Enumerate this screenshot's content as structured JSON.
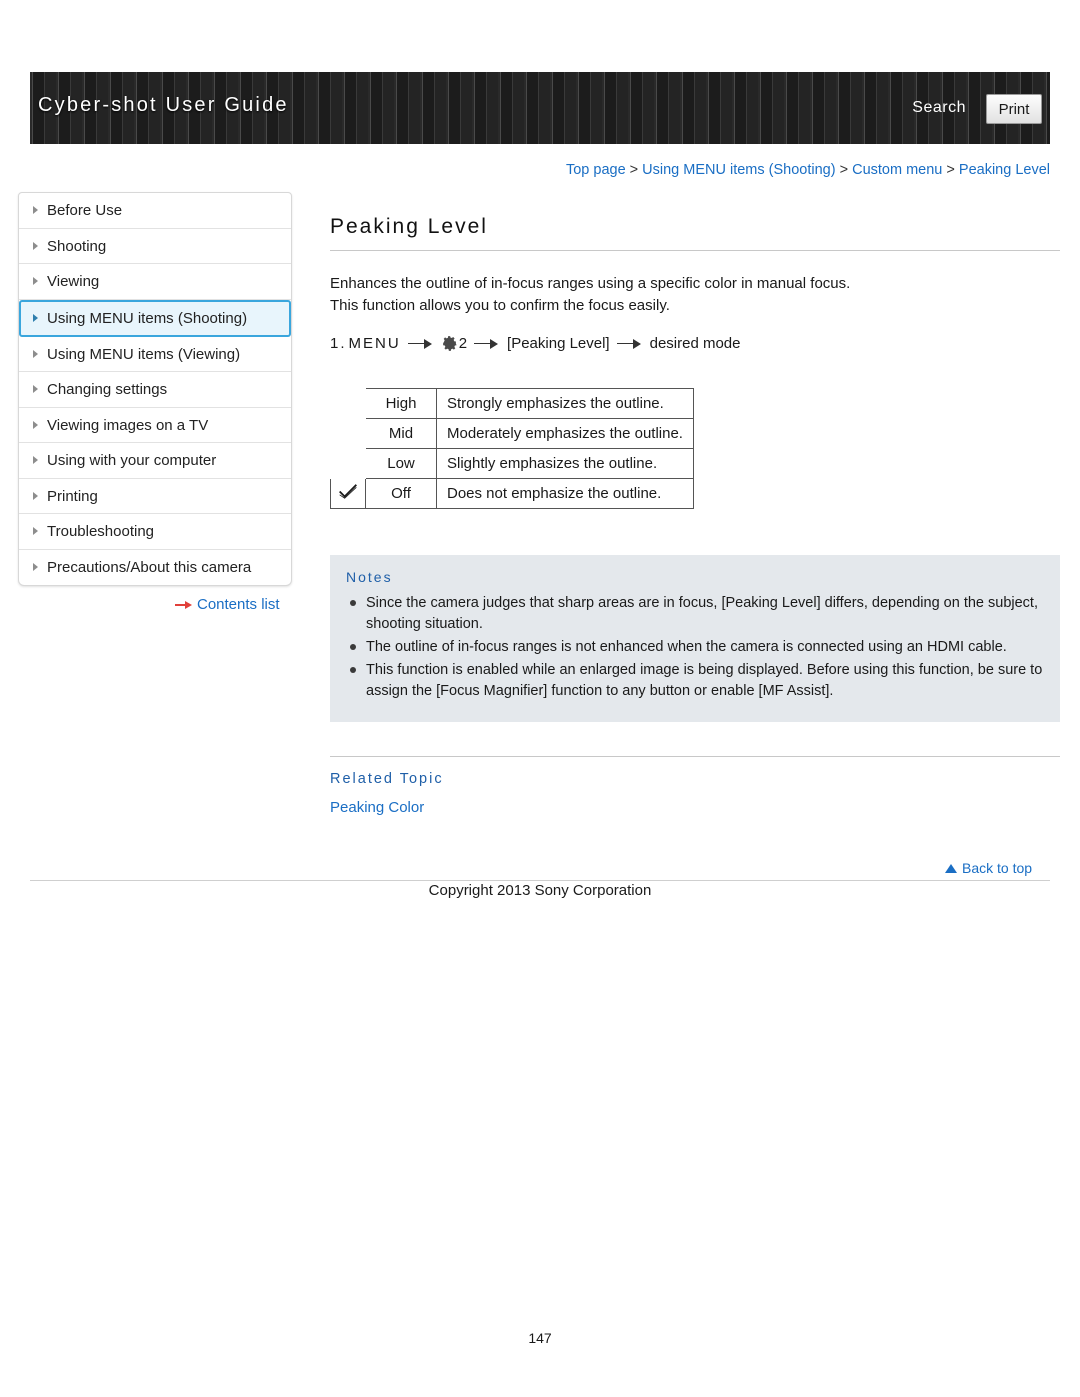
{
  "header": {
    "title": "Cyber-shot User Guide",
    "search_label": "Search",
    "print_label": "Print"
  },
  "breadcrumb": {
    "items": [
      "Top page",
      "Using MENU items (Shooting)",
      "Custom menu",
      "Peaking Level"
    ],
    "separator": ">"
  },
  "sidebar": {
    "items": [
      {
        "label": "Before Use",
        "active": false
      },
      {
        "label": "Shooting",
        "active": false
      },
      {
        "label": "Viewing",
        "active": false
      },
      {
        "label": "Using MENU items (Shooting)",
        "active": true
      },
      {
        "label": "Using MENU items (Viewing)",
        "active": false
      },
      {
        "label": "Changing settings",
        "active": false
      },
      {
        "label": "Viewing images on a TV",
        "active": false
      },
      {
        "label": "Using with your computer",
        "active": false
      },
      {
        "label": "Printing",
        "active": false
      },
      {
        "label": "Troubleshooting",
        "active": false
      },
      {
        "label": "Precautions/About this camera",
        "active": false
      }
    ],
    "contents_list_label": "Contents list"
  },
  "main": {
    "page_title": "Peaking Level",
    "intro_line1": "Enhances the outline of in-focus ranges using a specific color in manual focus.",
    "intro_line2": "This function allows you to confirm the focus easily.",
    "step": {
      "number": "1.",
      "menu_label": "MENU",
      "gear_number": "2",
      "item_label": "[Peaking Level]",
      "tail_label": "desired mode"
    },
    "options": [
      {
        "checked": false,
        "label": "High",
        "description": "Strongly emphasizes the outline."
      },
      {
        "checked": false,
        "label": "Mid",
        "description": "Moderately emphasizes the outline."
      },
      {
        "checked": false,
        "label": "Low",
        "description": "Slightly emphasizes the outline."
      },
      {
        "checked": true,
        "label": "Off",
        "description": "Does not emphasize the outline."
      }
    ],
    "notes": {
      "title": "Notes",
      "items": [
        "Since the camera judges that sharp areas are in focus, [Peaking Level] differs, depending on the subject, shooting situation.",
        "The outline of in-focus ranges is not enhanced when the camera is connected using an HDMI cable.",
        "This function is enabled while an enlarged image is being displayed. Before using this function, be sure to assign the [Focus Magnifier] function to any button or enable [MF Assist]."
      ]
    },
    "related": {
      "title": "Related Topic",
      "links": [
        "Peaking Color"
      ]
    }
  },
  "footer": {
    "back_to_top": "Back to top",
    "copyright": "Copyright 2013 Sony Corporation",
    "page_number": "147"
  },
  "colors": {
    "link": "#1a6ec4",
    "accent": "#3aa6dd",
    "notes_bg": "#e4e8ec",
    "heading_blue": "#1f5fa8"
  }
}
